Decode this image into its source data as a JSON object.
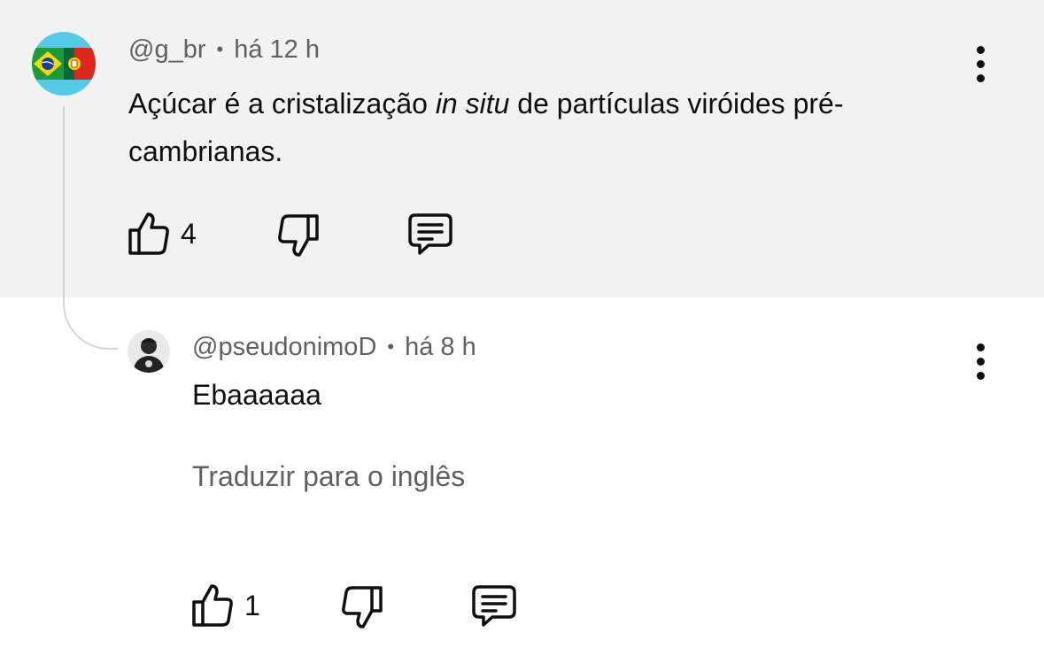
{
  "parent_comment": {
    "avatar": {
      "icon": "brazil-portugal-flags-avatar"
    },
    "username": "@g_br",
    "separator": "•",
    "time": "há 12 h",
    "text_before": "Açúcar é a cristalização ",
    "text_italic": "in situ",
    "text_after": " de partículas viróides pré-cambrianas.",
    "likes": "4",
    "icons": {
      "like": "thumbs-up-icon",
      "dislike": "thumbs-down-icon",
      "reply": "reply-comment-icon",
      "menu": "more-vert-icon"
    }
  },
  "reply_comment": {
    "avatar": {
      "icon": "person-avatar"
    },
    "username": "@pseudonimoD",
    "separator": "•",
    "time": "há 8 h",
    "text": "Ebaaaaaa",
    "translate_label": "Traduzir para o inglês",
    "likes": "1",
    "icons": {
      "like": "thumbs-up-icon",
      "dislike": "thumbs-down-icon",
      "reply": "reply-comment-icon",
      "menu": "more-vert-icon"
    }
  },
  "colors": {
    "highlight_background": "#f2f2f2",
    "secondary_text": "#606060",
    "primary_text": "#0f0f0f",
    "thread_line": "#d6d6d6"
  }
}
